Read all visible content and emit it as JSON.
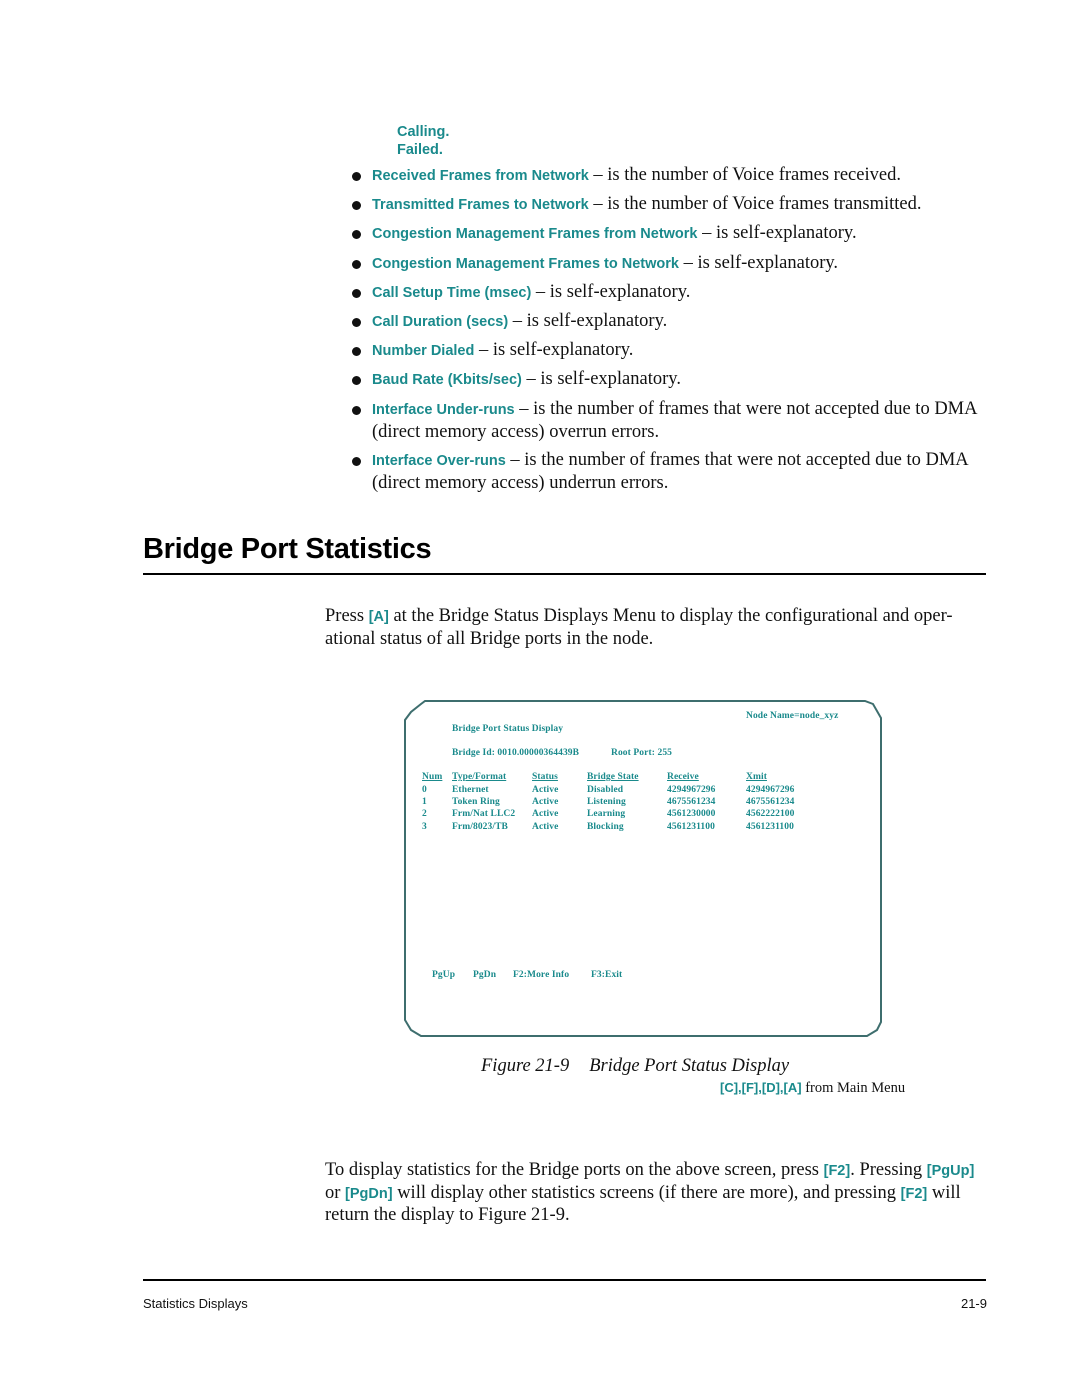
{
  "sublist": [
    "Calling.",
    "Failed."
  ],
  "bullets": [
    {
      "term": "Received Frames from Network",
      "desc": " – is the number of Voice frames received."
    },
    {
      "term": "Transmitted Frames to Network",
      "desc": " –  is the number of Voice frames transmitted."
    },
    {
      "term": "Congestion Management Frames from Network",
      "desc": "  – is self-explanatory."
    },
    {
      "term": "Congestion Management Frames to Network",
      "desc": " – is self-explanatory."
    },
    {
      "term": "Call Setup Time (msec)",
      "desc": " – is self-explanatory."
    },
    {
      "term": "Call Duration (secs)",
      "desc": " – is self-explanatory."
    },
    {
      "term": "Number Dialed",
      "desc": " – is self-explanatory."
    },
    {
      "term": "Baud Rate (Kbits/sec)",
      "desc": " –  is self-explanatory."
    },
    {
      "term": "Interface Under-runs",
      "desc": " – is the number of frames that were not accepted due to DMA (direct memory access) overrun errors."
    },
    {
      "term": "Interface Over-runs",
      "desc": " –  is the number of frames that were not accepted due to DMA (direct memory access) underrun errors."
    }
  ],
  "section": {
    "title": "Bridge Port Statistics",
    "intro_before": "Press ",
    "intro_key": "[A]",
    "intro_after": " at the Bridge Status Displays Menu to display the configurational and oper-ational status of all Bridge ports in the node."
  },
  "screen": {
    "node_name": "Node Name=node_xyz",
    "title": "Bridge Port Status Display",
    "bridge_id": "Bridge Id: 0010.00000364439B",
    "root_port": "Root Port: 255",
    "columns": [
      "Num",
      "Type/Format",
      "Status",
      "Bridge State",
      "Receive",
      "Xmit"
    ],
    "rows": [
      [
        "0",
        "Ethernet",
        "Active",
        "Disabled",
        "4294967296",
        "4294967296"
      ],
      [
        "1",
        "Token Ring",
        "Active",
        "Listening",
        "4675561234",
        "4675561234"
      ],
      [
        "2",
        "Frm/Nat LLC2",
        "Active",
        "Learning",
        "4561230000",
        "4562222100"
      ],
      [
        "3",
        "Frm/8023/TB",
        "Active",
        "Blocking",
        "4561231100",
        "4561231100"
      ]
    ],
    "function_keys": [
      "PgUp",
      "PgDn",
      "F2:More Info",
      "F3:Exit"
    ]
  },
  "figure": {
    "number": "Figure 21-9",
    "title": "Bridge Port Status Display",
    "menu_keys": "[C],[F],[D],[A]",
    "menu_suffix": " from Main Menu"
  },
  "closing": {
    "t1": "To display statistics for the Bridge ports on the above screen, press ",
    "k1": "[F2]",
    "t2": ". Pressing ",
    "k2": "[PgUp]",
    "t3": " or ",
    "k3": "[PgDn]",
    "t4": "  will display other statistics screens (if there are more), and pressing ",
    "k4": "[F2]",
    "t5": " will return the display to Figure 21-9."
  },
  "footer": {
    "left": "Statistics Displays",
    "right": "21-9"
  }
}
